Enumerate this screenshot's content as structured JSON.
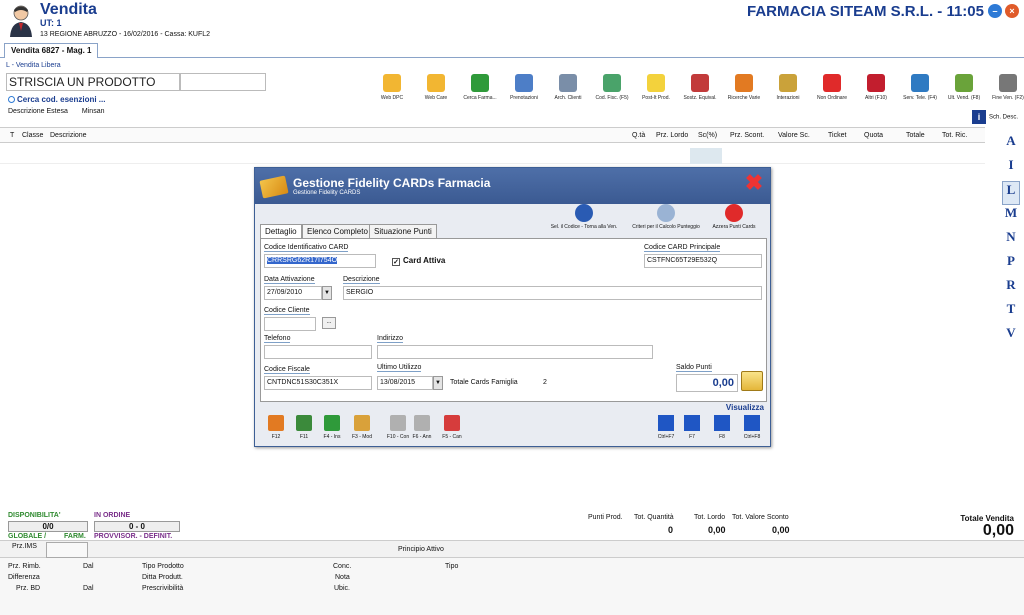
{
  "header": {
    "title": "Vendita",
    "ut": "UT: 1",
    "info": "13 REGIONE ABRUZZO - 16/02/2016 - Cassa: KUFL2",
    "pharmacy": "FARMACIA SITEAM S.R.L. - 11:05"
  },
  "tab": {
    "label": "Vendita 6827 - Mag. 1"
  },
  "sublabel": "L - Vendita Libera",
  "product": {
    "striscia": "STRISCIA UN PRODOTTO",
    "cerca": "Cerca cod. esenzioni ...",
    "desc_estesa": "Descrizione Estesa",
    "minsan": "Minsan"
  },
  "toolbar": {
    "items": [
      {
        "label": "Web DPC",
        "color": "#f2b632"
      },
      {
        "label": "Web Care",
        "color": "#f2b632"
      },
      {
        "label": "Cerca Farma...",
        "color": "#2f9a3a"
      },
      {
        "label": "Prenotazioni",
        "color": "#4d7ec7"
      },
      {
        "label": "Arch. Clienti",
        "color": "#7a8ea8"
      },
      {
        "label": "Cod. Fisc. (F5)",
        "color": "#4aa36a"
      },
      {
        "label": "Post-It Prod.",
        "color": "#f3d23c"
      },
      {
        "label": "Sostz. Equival.",
        "color": "#c23b3b"
      },
      {
        "label": "Ricerche Varie",
        "color": "#e27a22"
      },
      {
        "label": "Interazioni",
        "color": "#caa23a"
      },
      {
        "label": "Non Ordinare",
        "color": "#e02a2a"
      },
      {
        "label": "Altri (F10)",
        "color": "#c21e2e"
      },
      {
        "label": "Serv. Tele. (F4)",
        "color": "#2f7ac2"
      },
      {
        "label": "Ult. Vend. (F8)",
        "color": "#6aa33a"
      },
      {
        "label": "Fine Ven. (F2)",
        "color": "#777777"
      }
    ],
    "sch_desc": "Sch. Desc."
  },
  "grid": {
    "columns": [
      "T",
      "Classe",
      "Descrizione",
      "Q.tà",
      "Prz. Lordo",
      "Sc(%)",
      "Prz. Scont.",
      "Valore Sc.",
      "Ticket",
      "Quota",
      "Totale",
      "Tot. Ric."
    ]
  },
  "alphabet": [
    "A",
    "I",
    "L",
    "M",
    "N",
    "P",
    "R",
    "T",
    "V"
  ],
  "modal": {
    "title": "Gestione Fidelity CARDs Farmacia",
    "subtitle": "Gestione Fidelity CARDS",
    "tabs": [
      "Dettaglio",
      "Elenco Completo",
      "Situazione Punti"
    ],
    "actions": [
      {
        "label": "Sel. il Codice - Torna alla Ven.",
        "color": "#2a5bb3"
      },
      {
        "label": "Criteri per il Calcolo Punteggio",
        "color": "#9ab3d4"
      },
      {
        "label": "Azzera Punti Cards",
        "color": "#e02a2a"
      }
    ],
    "fields": {
      "codice_card_label": "Codice Identificativo CARD",
      "codice_card_value": "CRRSRG62R17I754O",
      "card_attiva_label": "Card Attiva",
      "card_attiva_check": "✓",
      "codice_principale_label": "Codice CARD Principale",
      "codice_principale_value": "CSTFNC65T29E532Q",
      "data_attivazione_label": "Data Attivazione",
      "data_attivazione_value": "27/09/2010",
      "descrizione_label": "Descrizione",
      "descrizione_value": "SERGIO",
      "codice_cliente_label": "Codice Cliente",
      "codice_cliente_btn": "...",
      "telefono_label": "Telefono",
      "indirizzo_label": "Indirizzo",
      "codice_fiscale_label": "Codice Fiscale",
      "codice_fiscale_value": "CNTDNC51S30C351X",
      "ultimo_utilizzo_label": "Ultimo Utilizzo",
      "ultimo_utilizzo_value": "13/08/2015",
      "tot_cards_label": "Totale Cards Famiglia",
      "tot_cards_value": "2",
      "saldo_label": "Saldo Punti",
      "saldo_value": "0,00"
    },
    "visualizza": "Visualizza",
    "footer": [
      {
        "label": "F12",
        "color": "#e27a22"
      },
      {
        "label": "F11",
        "color": "#3b8a3b"
      },
      {
        "label": "F4 - Ins",
        "color": "#2f9a3a"
      },
      {
        "label": "F3 - Mod",
        "color": "#d9a13a"
      },
      {
        "label": "F10 - Con",
        "color": "#b0b0b0"
      },
      {
        "label": "F6 - Ann",
        "color": "#b0b0b0"
      },
      {
        "label": "F5 - Can",
        "color": "#d63c3c"
      }
    ],
    "nav": [
      "Ctrl+F7",
      "F7",
      "F8",
      "Ctrl+F8"
    ]
  },
  "bottom": {
    "disponibilita": "DISPONIBILITA'",
    "in_ordine": "IN ORDINE",
    "dispo_value": "0/0",
    "ordine_value": "0 - 0",
    "globale": "GLOBALE /",
    "farm": "FARM.",
    "provvisor": "PROVVISOR. - DEFINIT.",
    "punti_prod": "Punti Prod.",
    "tot_quantita": "Tot. Quantità",
    "tot_quantita_val": "0",
    "tot_lordo": "Tot. Lordo",
    "tot_lordo_val": "0,00",
    "tot_val_sconto": "Tot. Valore Sconto",
    "tot_val_sconto_val": "0,00",
    "totale_vendita": "Totale Vendita",
    "totale_vendita_val": "0,00",
    "prz_ims": "Prz.IMS",
    "principio": "Principio Attivo",
    "prz_rimb": "Prz. Rimb.",
    "dal1": "Dal",
    "tipo_prodotto": "Tipo Prodotto",
    "conc": "Conc.",
    "tipo": "Tipo",
    "differenza": "Differenza",
    "ditta": "Ditta Produtt.",
    "nota": "Nota",
    "prz_bd": "Prz. BD",
    "dal2": "Dal",
    "prescrivibilita": "Prescrivibilità",
    "ubic": "Ubic."
  }
}
